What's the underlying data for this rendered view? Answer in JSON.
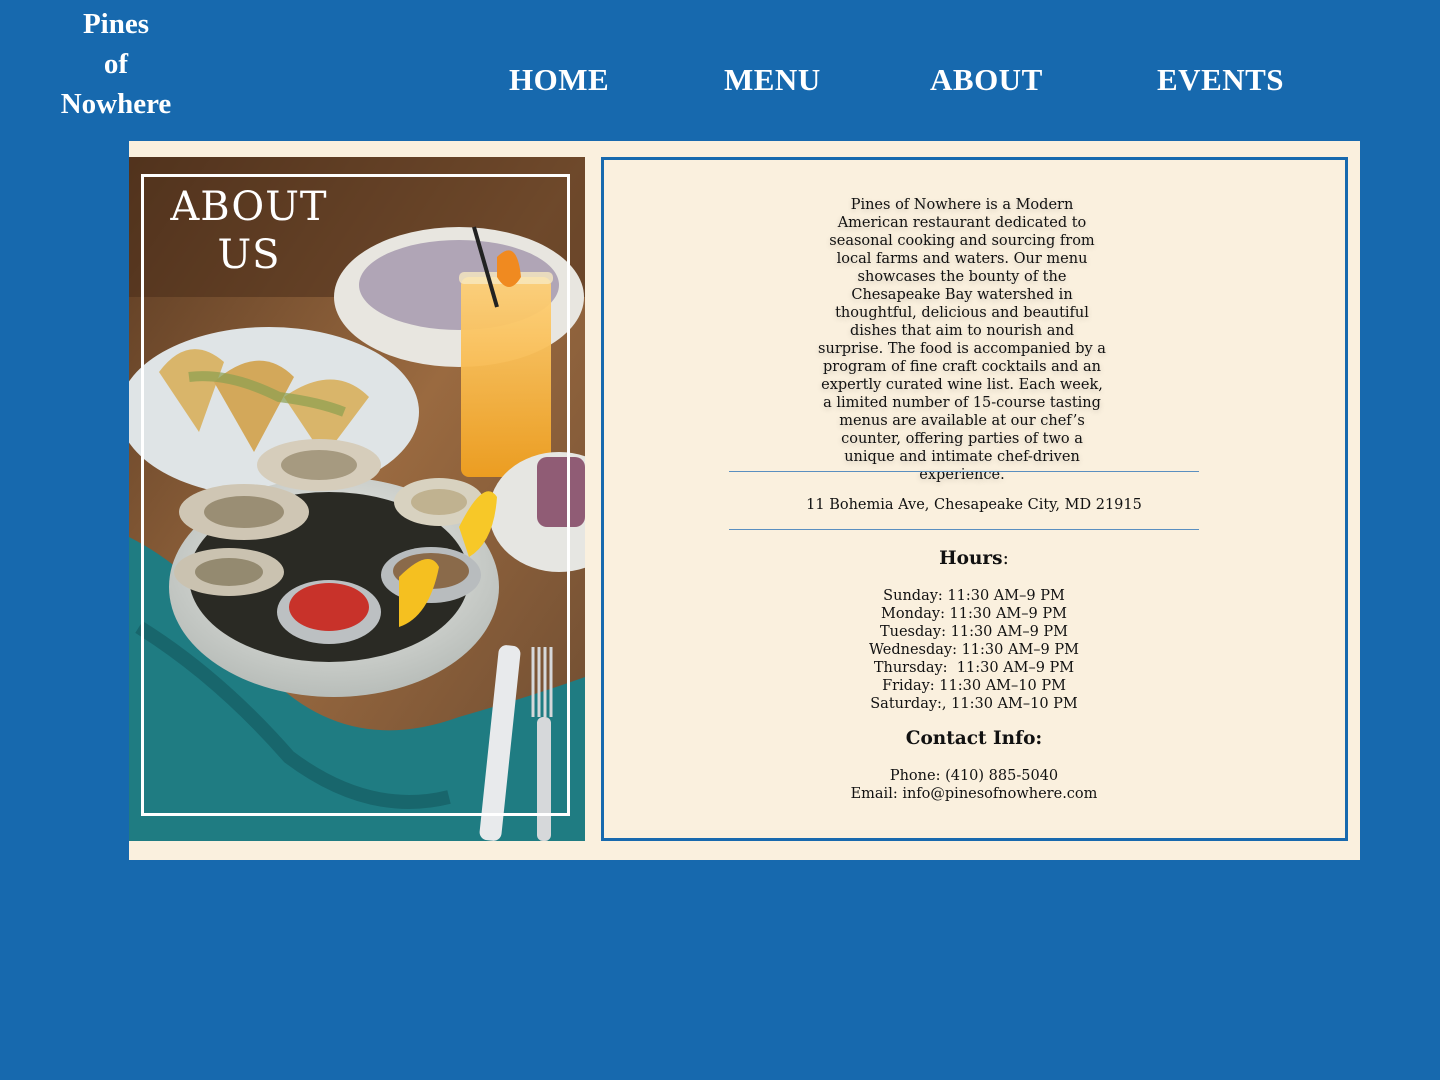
{
  "brand": {
    "line1": "Pines",
    "line2": "of",
    "line3": "Nowhere"
  },
  "nav": {
    "home": "HOME",
    "menu": "MENU",
    "about": "ABOUT",
    "events": "EVENTS"
  },
  "hero": {
    "title_line1": "ABOUT",
    "title_line2": "US",
    "image": "oysters-and-cocktail-photo"
  },
  "about": {
    "description": "Pines of Nowhere is a Modern American restaurant dedicated to seasonal cooking and sourcing from local farms and waters. Our menu showcases the bounty of the Chesapeake Bay watershed in thoughtful, delicious and beautiful dishes that aim to nourish and surprise. The food is accompanied by a program of fine craft cocktails and an expertly curated wine list. Each week, a limited number of 15-course tasting menus are available at our chef’s counter, offering parties of two a unique and intimate chef-driven experience.",
    "address": "11 Bohemia Ave, Chesapeake City, MD 21915"
  },
  "hours": {
    "heading": "Hours",
    "heading_suffix": ":",
    "sunday": "Sunday: 11:30 AM–9 PM",
    "monday": "Monday: 11:30 AM–9 PM",
    "tuesday": "Tuesday: 11:30 AM–9 PM",
    "wednesday": "Wednesday: 11:30 AM–9 PM",
    "thursday": "Thursday:  11:30 AM–9 PM",
    "friday": "Friday: 11:30 AM–10 PM",
    "saturday": "Saturday:, 11:30 AM–10 PM"
  },
  "contact": {
    "heading": "Contact Info:",
    "phone": "Phone: (410) 885-5040",
    "email": "Email: info@pinesofnowhere.com"
  },
  "colors": {
    "page_background": "#1769ae",
    "card_background": "#faf0de",
    "accent_border": "#1769ae",
    "text": "#111111",
    "nav_text": "#ffffff"
  }
}
